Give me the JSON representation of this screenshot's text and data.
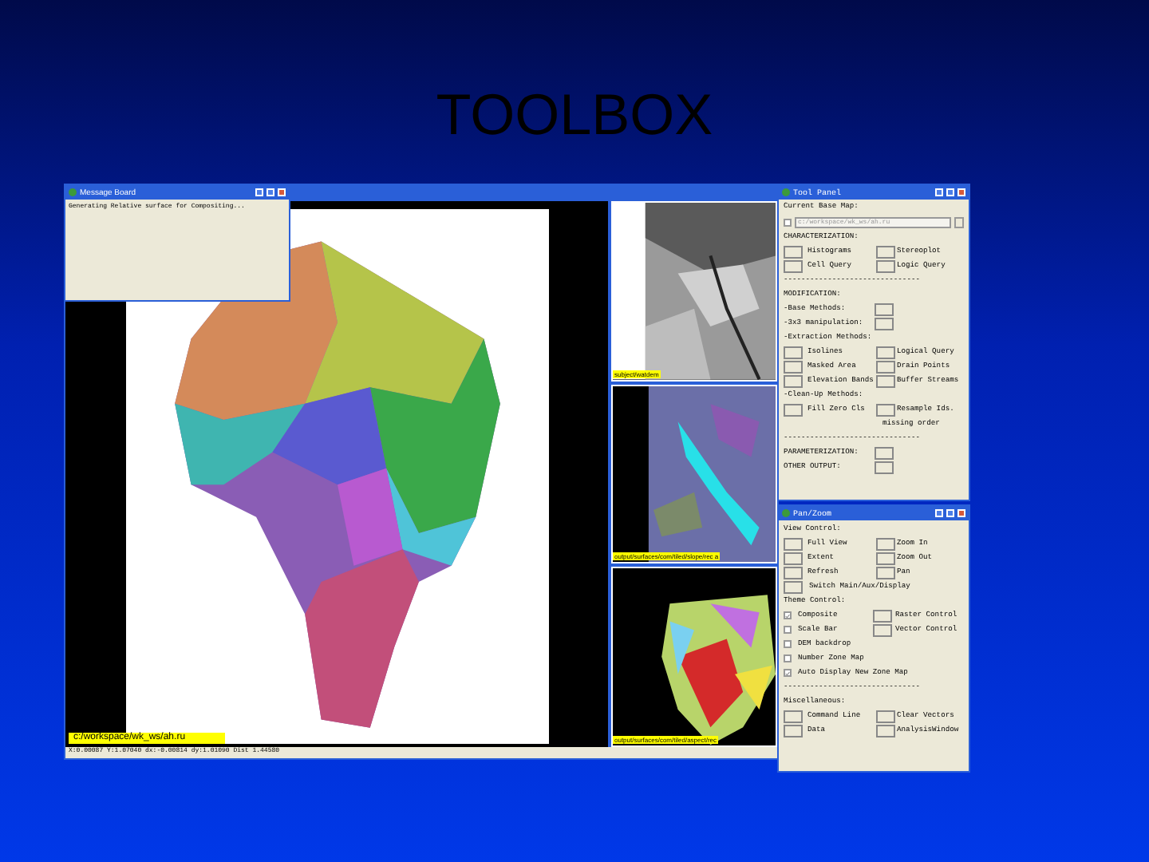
{
  "slide_title": "TOOLBOX",
  "main_window": {
    "path": "c:/workspace/wk_ws/ah.ru",
    "status": "X:0.00087 Y:1.07040 dx:-0.00814 dy:1.01090 Dist 1.44580"
  },
  "message_board": {
    "title": "Message Board",
    "text": "Generating Relative surface for Compositing..."
  },
  "thumbnails": [
    {
      "path": "subject/watdem"
    },
    {
      "path": "output/surfaces/com/tiled/slope/rec a"
    },
    {
      "path": "output/surfaces/com/tiled/aspect/rec"
    }
  ],
  "tool_panel": {
    "title": "Tool Panel",
    "base_map_label": "Current Base Map:",
    "base_map_checked": false,
    "base_map_value": "c:/workspace/wk_ws/ah.ru",
    "rows": [
      {
        "kind": "heading",
        "text": "CHARACTERIZATION:"
      },
      {
        "kind": "buttons",
        "left": "Histograms",
        "right": "Stereoplot"
      },
      {
        "kind": "buttons",
        "left": "Cell Query",
        "right": "Logic Query"
      },
      {
        "kind": "heading",
        "text": "-------------------------------"
      },
      {
        "kind": "heading",
        "text": "MODIFICATION:"
      },
      {
        "kind": "labelbutton",
        "text": "-Base Methods:"
      },
      {
        "kind": "labelbutton",
        "text": "-3x3 manipulation:"
      },
      {
        "kind": "heading",
        "text": "-Extraction Methods:"
      },
      {
        "kind": "buttons",
        "left": "Isolines",
        "right": "Logical Query"
      },
      {
        "kind": "buttons",
        "left": "Masked Area",
        "right": "Drain Points"
      },
      {
        "kind": "buttons",
        "left": "Elevation Bands",
        "right": "Buffer Streams"
      },
      {
        "kind": "heading",
        "text": "-Clean-Up Methods:"
      },
      {
        "kind": "buttons",
        "left": "Fill Zero Cls",
        "right": "Resample Ids."
      },
      {
        "kind": "indent",
        "text": "missing order"
      },
      {
        "kind": "heading",
        "text": "-------------------------------"
      },
      {
        "kind": "labelbutton",
        "text": "PARAMETERIZATION:"
      },
      {
        "kind": "labelbutton",
        "text": "OTHER OUTPUT:"
      }
    ]
  },
  "pan_zoom": {
    "title": "Pan/Zoom",
    "rows": [
      {
        "kind": "heading",
        "text": "View Control:"
      },
      {
        "kind": "buttons",
        "left": "Full View",
        "right": "Zoom In"
      },
      {
        "kind": "buttons",
        "left": "Extent",
        "right": "Zoom Out"
      },
      {
        "kind": "buttons",
        "left": "Refresh",
        "right": "Pan"
      },
      {
        "kind": "button",
        "left": "Switch Main/Aux/Display"
      },
      {
        "kind": "heading",
        "text": "Theme Control:"
      },
      {
        "kind": "check",
        "checked": true,
        "left": "Composite",
        "right": "Raster Control"
      },
      {
        "kind": "check",
        "checked": false,
        "left": "Scale Bar",
        "right": "Vector Control"
      },
      {
        "kind": "check",
        "checked": false,
        "left": "DEM backdrop"
      },
      {
        "kind": "check",
        "checked": false,
        "left": "Number Zone Map"
      },
      {
        "kind": "check",
        "checked": true,
        "left": "Auto Display New Zone Map"
      },
      {
        "kind": "heading",
        "text": "-------------------------------"
      },
      {
        "kind": "heading",
        "text": "Miscellaneous:"
      },
      {
        "kind": "buttons",
        "left": "Command Line",
        "right": "Clear Vectors"
      },
      {
        "kind": "buttons",
        "left": "Data",
        "right": "AnalysisWindow"
      }
    ]
  }
}
